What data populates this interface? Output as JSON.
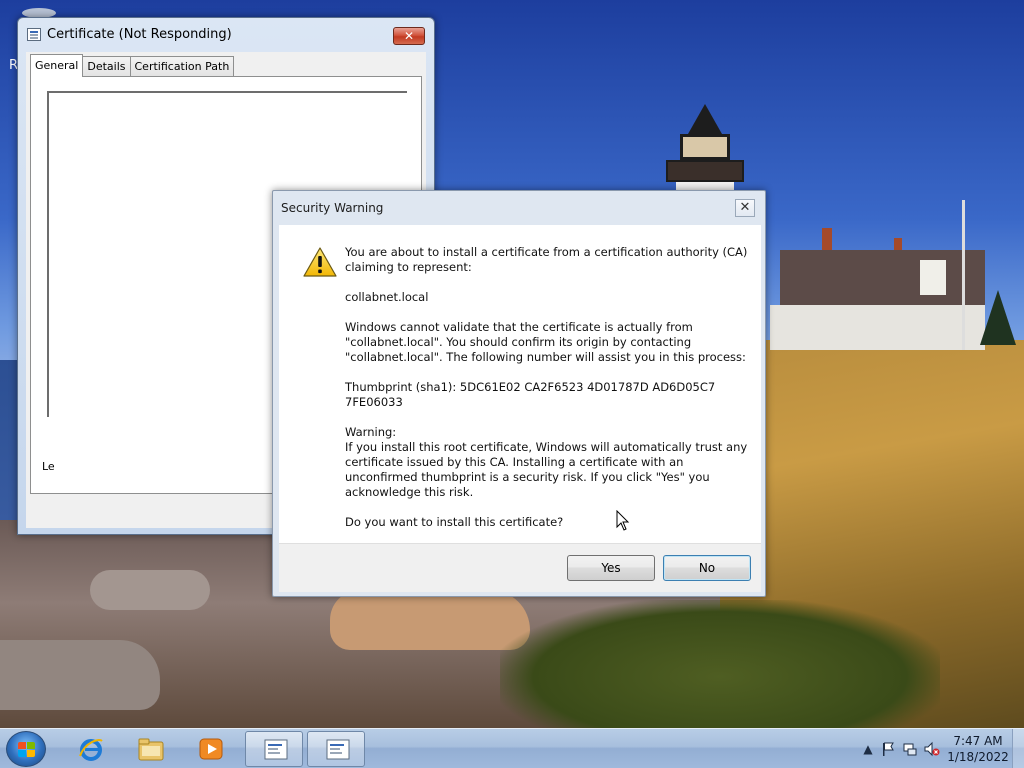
{
  "desktop": {
    "partial_icon_label": "R"
  },
  "certificate_window": {
    "title": "Certificate (Not Responding)",
    "close_label": "✕",
    "tabs": [
      {
        "label": "General",
        "active": true
      },
      {
        "label": "Details",
        "active": false
      },
      {
        "label": "Certification Path",
        "active": false
      }
    ],
    "partial_text": "Le"
  },
  "security_warning": {
    "title": "Security Warning",
    "close_label": "✕",
    "icon": "warning-icon",
    "paragraphs": {
      "intro": "You are about to install a certificate from a certification authority (CA) claiming to represent:",
      "ca_name": "collabnet.local",
      "validation": "Windows cannot validate that the certificate is actually from \"collabnet.local\". You should confirm its origin by contacting \"collabnet.local\". The following number will assist you in this process:",
      "thumbprint": "Thumbprint (sha1): 5DC61E02 CA2F6523 4D01787D AD6D05C7 7FE06033",
      "warning_heading": "Warning:",
      "warning_body": "If you install this root certificate, Windows will automatically trust any certificate issued by this CA. Installing a certificate with an unconfirmed thumbprint is a security risk. If you click \"Yes\" you acknowledge this risk.",
      "question": "Do you want to install this certificate?"
    },
    "buttons": {
      "yes": "Yes",
      "no": "No"
    }
  },
  "taskbar": {
    "pinned": [
      {
        "name": "internet-explorer-icon",
        "open": false
      },
      {
        "name": "windows-explorer-icon",
        "open": false
      },
      {
        "name": "media-player-icon",
        "open": false
      },
      {
        "name": "certificate-app-icon",
        "open": true
      },
      {
        "name": "certificate-app-icon",
        "open": true
      }
    ],
    "tray": {
      "icons": [
        "show-hidden-icons",
        "action-center-flag-icon",
        "network-icon",
        "volume-muted-icon"
      ],
      "time": "7:47 AM",
      "date": "1/18/2022"
    }
  },
  "colors": {
    "taskbar": "#a7bfdd",
    "close_red": "#c23a22",
    "default_button_border": "#3c7fb1"
  }
}
